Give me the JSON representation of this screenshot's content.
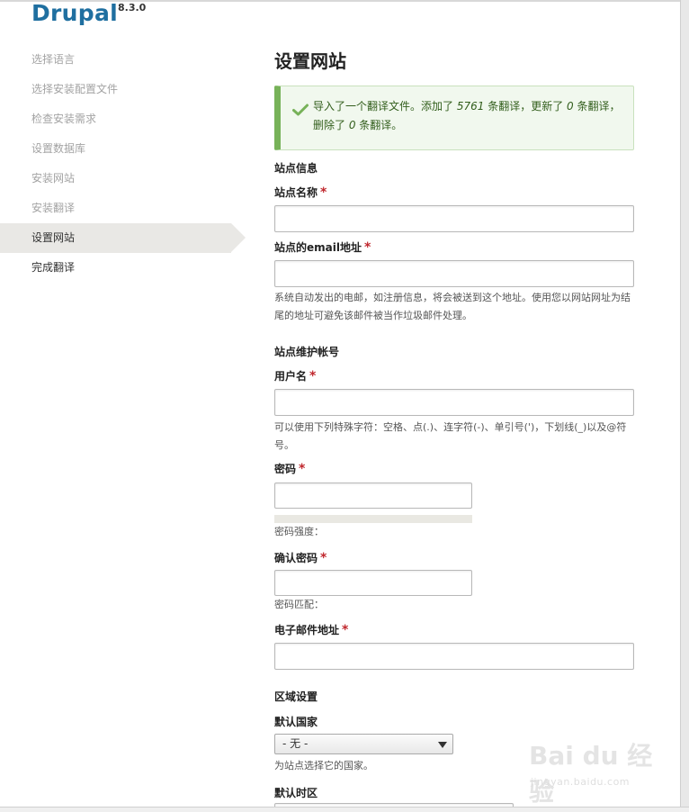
{
  "brand": {
    "name": "Drupal",
    "version": "8.3.0"
  },
  "steps": [
    {
      "label": "选择语言"
    },
    {
      "label": "选择安装配置文件"
    },
    {
      "label": "检查安装需求"
    },
    {
      "label": "设置数据库"
    },
    {
      "label": "安装网站"
    },
    {
      "label": "安装翻译"
    },
    {
      "label": "设置网站"
    },
    {
      "label": "完成翻译"
    }
  ],
  "main": {
    "title": "设置网站",
    "message": {
      "part1": "导入了一个翻译文件。添加了 ",
      "added": "5761",
      "part2": " 条翻译，更新了 ",
      "updated": "0",
      "part3": " 条翻译，删除了 ",
      "deleted": "0",
      "part4": " 条翻译。"
    },
    "site_info": {
      "heading": "站点信息",
      "site_name_label": "站点名称",
      "site_name_value": "",
      "email_label": "站点的email地址",
      "email_value": "",
      "email_desc": "系统自动发出的电邮，如注册信息，将会被送到这个地址。使用您以网站网址为结尾的地址可避免该邮件被当作垃圾邮件处理。"
    },
    "account": {
      "heading": "站点维护帐号",
      "username_label": "用户名",
      "username_value": "",
      "username_desc": "可以使用下列特殊字符：空格、点(.)、连字符(-)、单引号(')，下划线(_)以及@符号。",
      "password_label": "密码",
      "password_strength": "密码强度：",
      "confirm_label": "确认密码",
      "confirm_match": "密码匹配：",
      "email_label": "电子邮件地址",
      "email_value": ""
    },
    "regional": {
      "heading": "区域设置",
      "country_label": "默认国家",
      "country_selected": "- 无 -",
      "country_desc": "为站点选择它的国家。",
      "timezone_label": "默认时区"
    },
    "required_marker": "*"
  },
  "watermark": {
    "logo": "Bai du 经验",
    "url": "jingyan.baidu.com"
  },
  "colors": {
    "brand": "#1f6fa0",
    "success_border": "#77b259",
    "required": "#c0272d"
  }
}
